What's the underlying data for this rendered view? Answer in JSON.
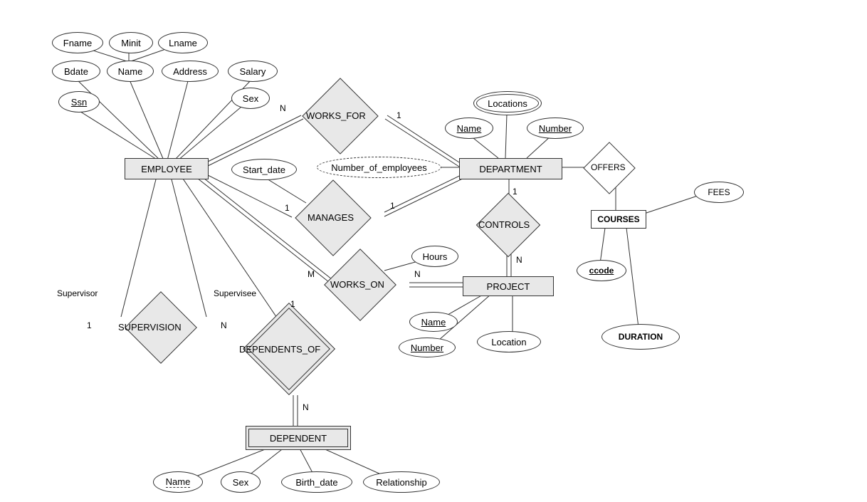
{
  "entities": {
    "employee": "EMPLOYEE",
    "department": "DEPARTMENT",
    "project": "PROJECT",
    "dependent": "DEPENDENT",
    "courses": "COURSES"
  },
  "relationships": {
    "works_for": "WORKS_FOR",
    "manages": "MANAGES",
    "controls": "CONTROLS",
    "works_on": "WORKS_ON",
    "supervision": "SUPERVISION",
    "dependents_of": "DEPENDENTS_OF",
    "offers": "OFFERS"
  },
  "attributes": {
    "fname": "Fname",
    "minit": "Minit",
    "lname": "Lname",
    "bdate": "Bdate",
    "name_emp": "Name",
    "address": "Address",
    "salary": "Salary",
    "ssn": "Ssn",
    "sex": "Sex",
    "start_date": "Start_date",
    "num_employees": "Number_of_employees",
    "locations": "Locations",
    "name_dept": "Name",
    "number_dept": "Number",
    "hours": "Hours",
    "name_proj": "Name",
    "number_proj": "Number",
    "location_proj": "Location",
    "name_dep": "Name",
    "sex_dep": "Sex",
    "birth_date": "Birth_date",
    "relationship_attr": "Relationship",
    "fees": "FEES",
    "ccode": "ccode",
    "duration": "DURATION"
  },
  "roles": {
    "supervisor": "Supervisor",
    "supervisee": "Supervisee"
  },
  "cardinalities": {
    "one": "1",
    "N": "N",
    "M": "M"
  }
}
